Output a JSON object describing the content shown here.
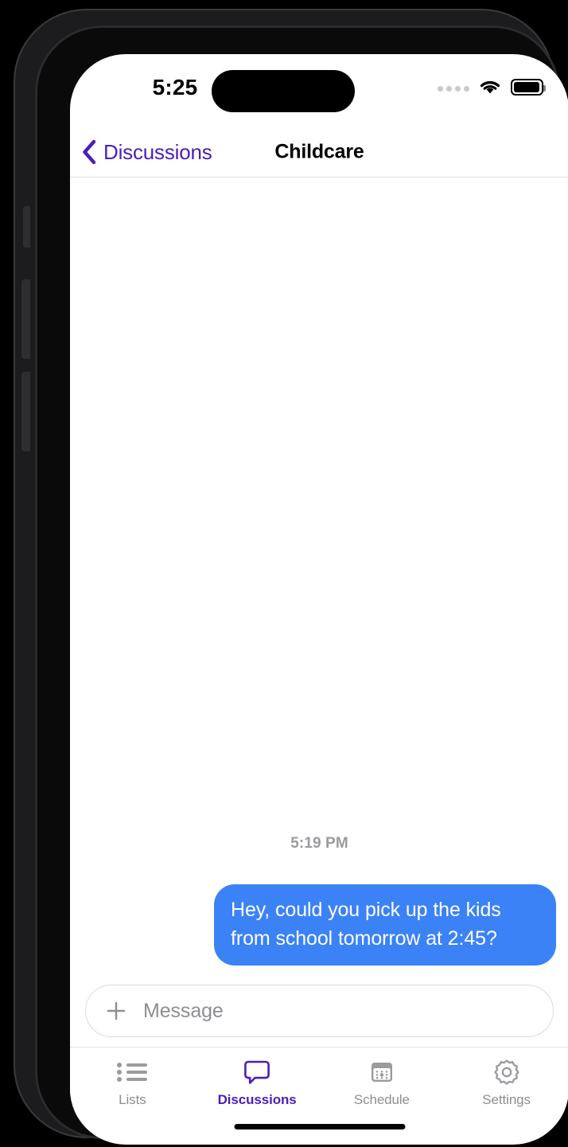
{
  "status_bar": {
    "time": "5:25",
    "signal_icon": "signal-dots-icon",
    "wifi_icon": "wifi-icon",
    "battery_icon": "battery-icon"
  },
  "nav_bar": {
    "back_icon": "chevron-left-icon",
    "back_label": "Discussions",
    "title": "Childcare"
  },
  "conversation": {
    "timestamp": "5:19 PM",
    "messages": [
      {
        "text": "Hey, could you pick up the kids from school tomorrow at 2:45?",
        "direction": "outgoing"
      }
    ]
  },
  "composer": {
    "add_icon": "plus-icon",
    "placeholder": "Message",
    "value": ""
  },
  "tab_bar": {
    "items": [
      {
        "label": "Lists",
        "icon": "list-icon",
        "active": false
      },
      {
        "label": "Discussions",
        "icon": "chat-bubble-icon",
        "active": true
      },
      {
        "label": "Schedule",
        "icon": "calendar-icon",
        "active": false
      },
      {
        "label": "Settings",
        "icon": "gear-icon",
        "active": false
      }
    ]
  },
  "colors": {
    "accent_purple": "#4a1fb8",
    "bubble_blue": "#3b82f6",
    "inactive_gray": "#8e8e93"
  }
}
